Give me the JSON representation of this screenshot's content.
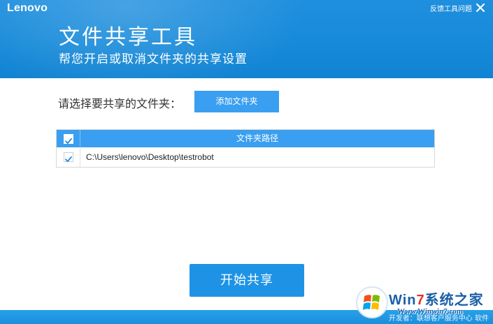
{
  "header": {
    "brand": "Lenovo",
    "feedback_label": "反馈工具问题",
    "close_icon": "close-icon",
    "title": "文件共享工具",
    "subtitle": "帮您开启或取消文件夹的共享设置"
  },
  "folder_select": {
    "label": "请选择要共享的文件夹：",
    "add_button": "添加文件夹"
  },
  "table": {
    "columns": [
      "",
      "文件夹路径"
    ],
    "select_all_checked": true,
    "rows": [
      {
        "checked": true,
        "path": "C:\\Users\\lenovo\\Desktop\\testrobot"
      }
    ]
  },
  "actions": {
    "start_button": "开始共享"
  },
  "footer": {
    "text": "开发者：联想客户服务中心 软件"
  },
  "watermark": {
    "title_prefix": "Win",
    "title_seven": "7",
    "title_suffix": "系统之家",
    "url": "Www.Winwin7.com"
  },
  "colors": {
    "header_blue": "#178ad9",
    "button_blue": "#3a9ff0",
    "start_button_blue": "#1e93e6",
    "check_blue": "#1e88e5"
  }
}
